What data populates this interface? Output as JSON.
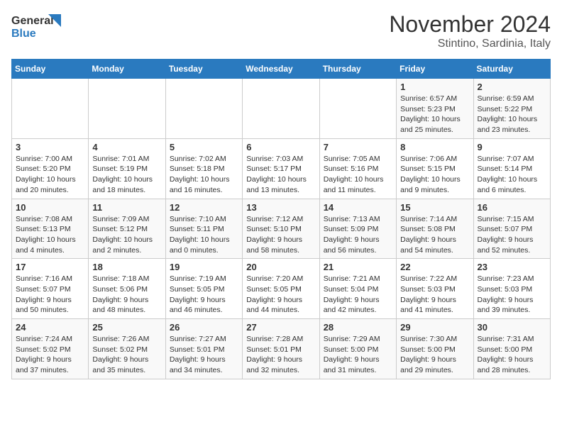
{
  "header": {
    "logo_line1": "General",
    "logo_line2": "Blue",
    "title": "November 2024",
    "subtitle": "Stintino, Sardinia, Italy"
  },
  "weekdays": [
    "Sunday",
    "Monday",
    "Tuesday",
    "Wednesday",
    "Thursday",
    "Friday",
    "Saturday"
  ],
  "weeks": [
    [
      {
        "day": "",
        "info": ""
      },
      {
        "day": "",
        "info": ""
      },
      {
        "day": "",
        "info": ""
      },
      {
        "day": "",
        "info": ""
      },
      {
        "day": "",
        "info": ""
      },
      {
        "day": "1",
        "info": "Sunrise: 6:57 AM\nSunset: 5:23 PM\nDaylight: 10 hours and 25 minutes."
      },
      {
        "day": "2",
        "info": "Sunrise: 6:59 AM\nSunset: 5:22 PM\nDaylight: 10 hours and 23 minutes."
      }
    ],
    [
      {
        "day": "3",
        "info": "Sunrise: 7:00 AM\nSunset: 5:20 PM\nDaylight: 10 hours and 20 minutes."
      },
      {
        "day": "4",
        "info": "Sunrise: 7:01 AM\nSunset: 5:19 PM\nDaylight: 10 hours and 18 minutes."
      },
      {
        "day": "5",
        "info": "Sunrise: 7:02 AM\nSunset: 5:18 PM\nDaylight: 10 hours and 16 minutes."
      },
      {
        "day": "6",
        "info": "Sunrise: 7:03 AM\nSunset: 5:17 PM\nDaylight: 10 hours and 13 minutes."
      },
      {
        "day": "7",
        "info": "Sunrise: 7:05 AM\nSunset: 5:16 PM\nDaylight: 10 hours and 11 minutes."
      },
      {
        "day": "8",
        "info": "Sunrise: 7:06 AM\nSunset: 5:15 PM\nDaylight: 10 hours and 9 minutes."
      },
      {
        "day": "9",
        "info": "Sunrise: 7:07 AM\nSunset: 5:14 PM\nDaylight: 10 hours and 6 minutes."
      }
    ],
    [
      {
        "day": "10",
        "info": "Sunrise: 7:08 AM\nSunset: 5:13 PM\nDaylight: 10 hours and 4 minutes."
      },
      {
        "day": "11",
        "info": "Sunrise: 7:09 AM\nSunset: 5:12 PM\nDaylight: 10 hours and 2 minutes."
      },
      {
        "day": "12",
        "info": "Sunrise: 7:10 AM\nSunset: 5:11 PM\nDaylight: 10 hours and 0 minutes."
      },
      {
        "day": "13",
        "info": "Sunrise: 7:12 AM\nSunset: 5:10 PM\nDaylight: 9 hours and 58 minutes."
      },
      {
        "day": "14",
        "info": "Sunrise: 7:13 AM\nSunset: 5:09 PM\nDaylight: 9 hours and 56 minutes."
      },
      {
        "day": "15",
        "info": "Sunrise: 7:14 AM\nSunset: 5:08 PM\nDaylight: 9 hours and 54 minutes."
      },
      {
        "day": "16",
        "info": "Sunrise: 7:15 AM\nSunset: 5:07 PM\nDaylight: 9 hours and 52 minutes."
      }
    ],
    [
      {
        "day": "17",
        "info": "Sunrise: 7:16 AM\nSunset: 5:07 PM\nDaylight: 9 hours and 50 minutes."
      },
      {
        "day": "18",
        "info": "Sunrise: 7:18 AM\nSunset: 5:06 PM\nDaylight: 9 hours and 48 minutes."
      },
      {
        "day": "19",
        "info": "Sunrise: 7:19 AM\nSunset: 5:05 PM\nDaylight: 9 hours and 46 minutes."
      },
      {
        "day": "20",
        "info": "Sunrise: 7:20 AM\nSunset: 5:05 PM\nDaylight: 9 hours and 44 minutes."
      },
      {
        "day": "21",
        "info": "Sunrise: 7:21 AM\nSunset: 5:04 PM\nDaylight: 9 hours and 42 minutes."
      },
      {
        "day": "22",
        "info": "Sunrise: 7:22 AM\nSunset: 5:03 PM\nDaylight: 9 hours and 41 minutes."
      },
      {
        "day": "23",
        "info": "Sunrise: 7:23 AM\nSunset: 5:03 PM\nDaylight: 9 hours and 39 minutes."
      }
    ],
    [
      {
        "day": "24",
        "info": "Sunrise: 7:24 AM\nSunset: 5:02 PM\nDaylight: 9 hours and 37 minutes."
      },
      {
        "day": "25",
        "info": "Sunrise: 7:26 AM\nSunset: 5:02 PM\nDaylight: 9 hours and 35 minutes."
      },
      {
        "day": "26",
        "info": "Sunrise: 7:27 AM\nSunset: 5:01 PM\nDaylight: 9 hours and 34 minutes."
      },
      {
        "day": "27",
        "info": "Sunrise: 7:28 AM\nSunset: 5:01 PM\nDaylight: 9 hours and 32 minutes."
      },
      {
        "day": "28",
        "info": "Sunrise: 7:29 AM\nSunset: 5:00 PM\nDaylight: 9 hours and 31 minutes."
      },
      {
        "day": "29",
        "info": "Sunrise: 7:30 AM\nSunset: 5:00 PM\nDaylight: 9 hours and 29 minutes."
      },
      {
        "day": "30",
        "info": "Sunrise: 7:31 AM\nSunset: 5:00 PM\nDaylight: 9 hours and 28 minutes."
      }
    ]
  ]
}
